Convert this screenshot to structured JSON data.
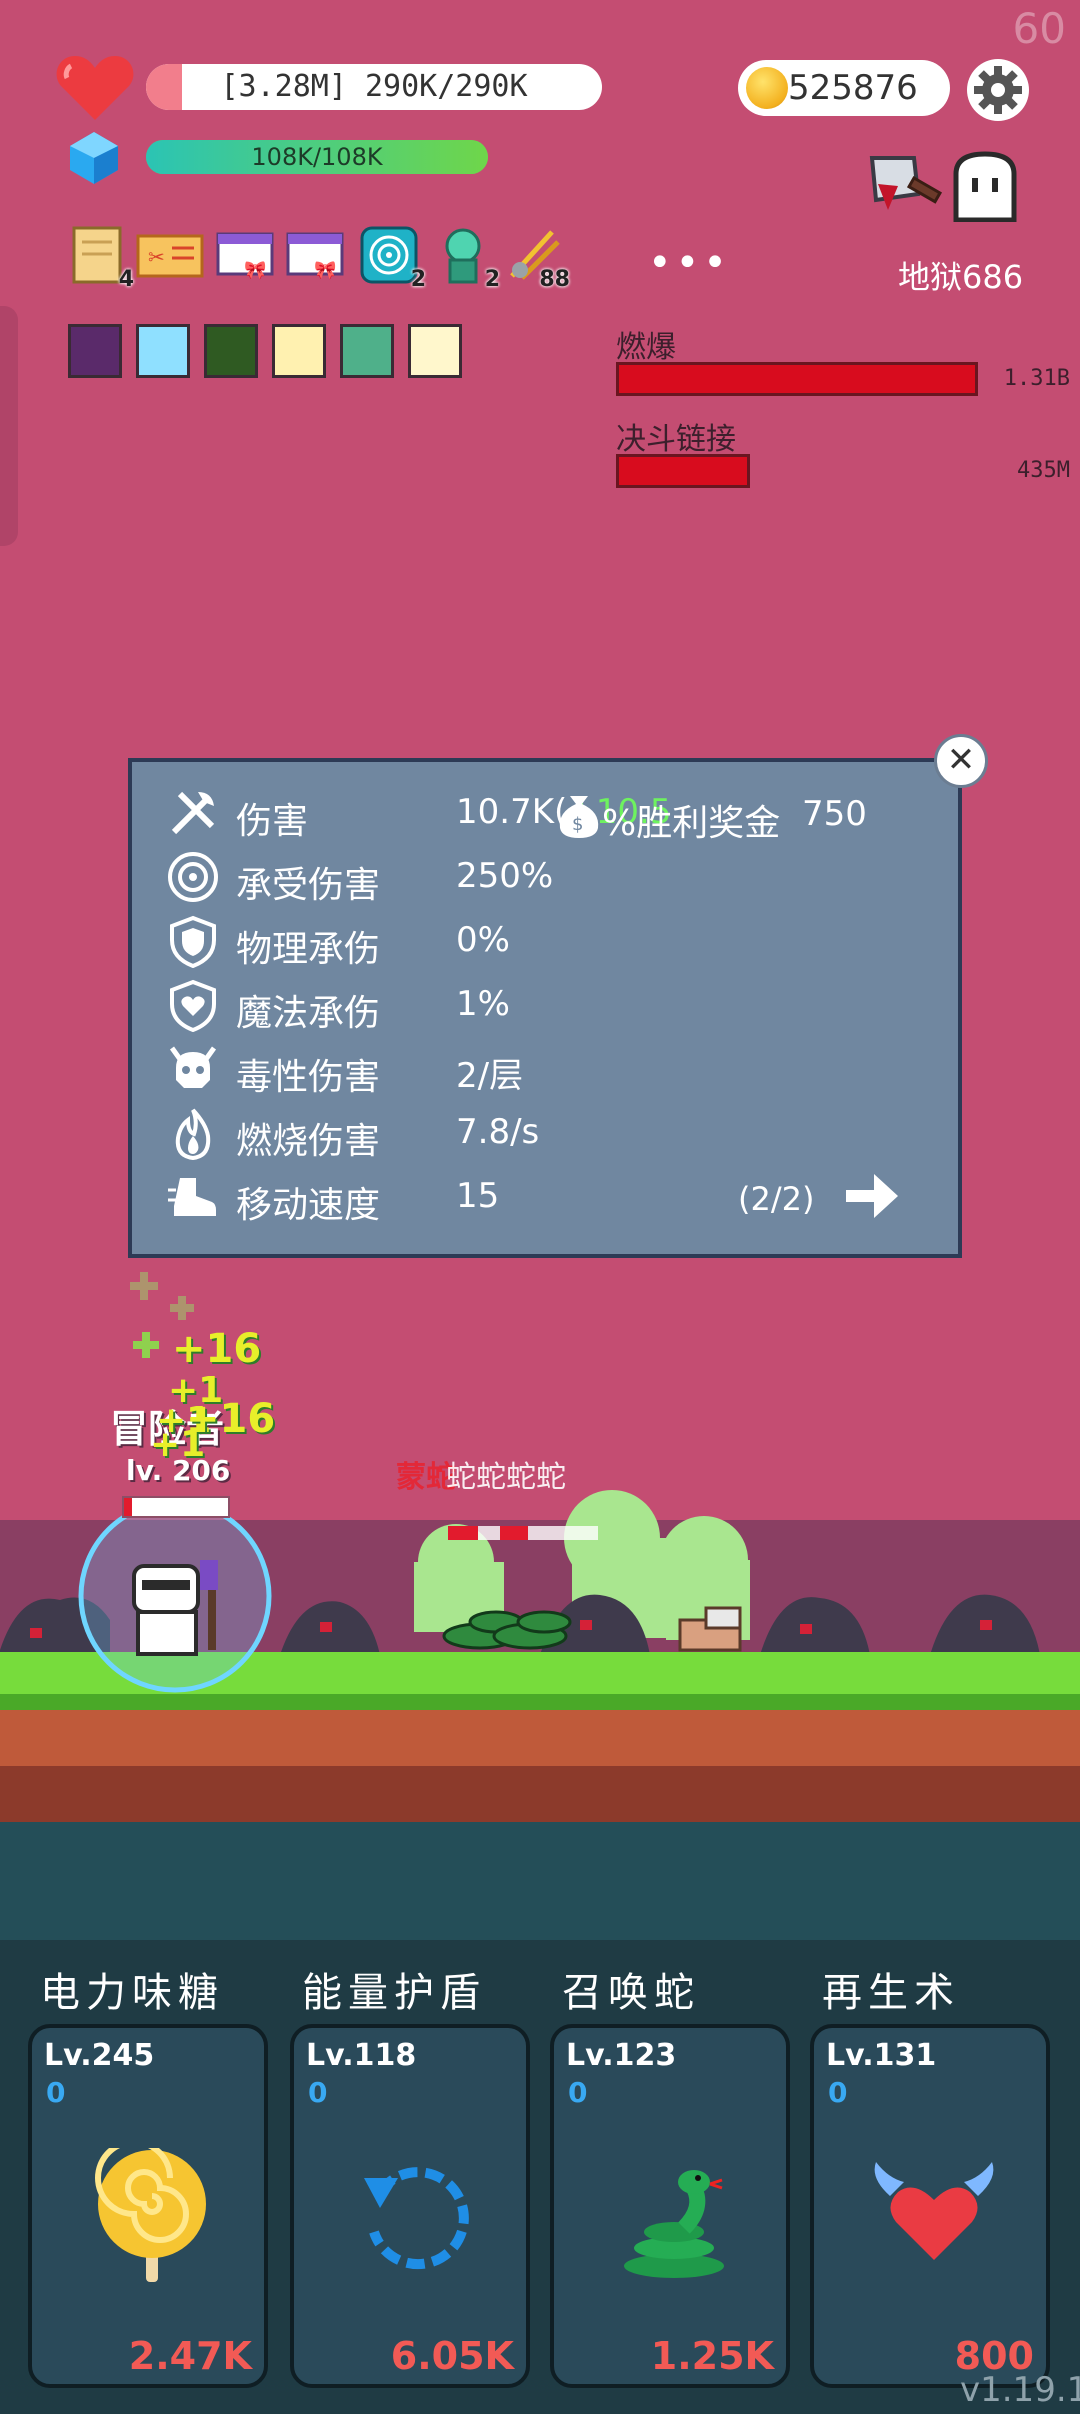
{
  "hud": {
    "fps": "60",
    "hp_text": "[3.28M] 290K/290K",
    "mana_text": "108K/108K",
    "coins": "525876",
    "stage": "地狱686"
  },
  "items": [
    {
      "icon": "scroll-icon",
      "count": "4"
    },
    {
      "icon": "ticket-icon",
      "count": ""
    },
    {
      "icon": "gift-card-icon",
      "count": ""
    },
    {
      "icon": "gift-card-icon",
      "count": ""
    },
    {
      "icon": "vortex-icon",
      "count": "2"
    },
    {
      "icon": "potion-icon",
      "count": "2"
    },
    {
      "icon": "bones-icon",
      "count": "88"
    }
  ],
  "buffs": [
    "demon-buff-icon",
    "light-buff-icon",
    "forest-buff-icon",
    "sun-buff-icon",
    "ghost-buff-icon",
    "plant-buff-icon"
  ],
  "damage_meters": [
    {
      "label": "燃爆",
      "value": "1.31B",
      "fraction": 1.0
    },
    {
      "label": "决斗链接",
      "value": "435M",
      "fraction": 0.37
    }
  ],
  "stats_panel": {
    "rows": [
      {
        "icon": "axe-icon",
        "label": "伤害",
        "value": "10.7K(",
        "bonus": "+10.5"
      },
      {
        "icon": "target-icon",
        "label": "承受伤害",
        "value": "250%"
      },
      {
        "icon": "shield-icon",
        "label": "物理承伤",
        "value": "0%"
      },
      {
        "icon": "heart-shield-icon",
        "label": "魔法承伤",
        "value": "1%"
      },
      {
        "icon": "skull-icon",
        "label": "毒性伤害",
        "value": "2/层"
      },
      {
        "icon": "fire-icon",
        "label": "燃烧伤害",
        "value": "7.8/s"
      },
      {
        "icon": "boot-icon",
        "label": "移动速度",
        "value": "15"
      }
    ],
    "prize_label": "%胜利奖金",
    "prize_value": "750",
    "page": "(2/2)"
  },
  "battle": {
    "player_name": "冒险者",
    "player_level": "lv. 206",
    "player_hp_fraction": 0.08,
    "popups": [
      "+16",
      "+1",
      "+1",
      "+16",
      "+1"
    ],
    "enemy_name": "蒙蛇",
    "enemy_sub": "蛇蛇蛇蛇"
  },
  "skills": [
    {
      "name": "电力味糖",
      "level": "Lv.245",
      "count": "0",
      "cost": "2.47K",
      "icon": "lollipop-icon"
    },
    {
      "name": "能量护盾",
      "level": "Lv.118",
      "count": "0",
      "cost": "6.05K",
      "icon": "refresh-icon"
    },
    {
      "name": "召唤蛇",
      "level": "Lv.123",
      "count": "0",
      "cost": "1.25K",
      "icon": "snake-icon"
    },
    {
      "name": "再生术",
      "level": "Lv.131",
      "count": "0",
      "cost": "800",
      "icon": "winged-heart-icon"
    }
  ],
  "version": "v1.19.1"
}
